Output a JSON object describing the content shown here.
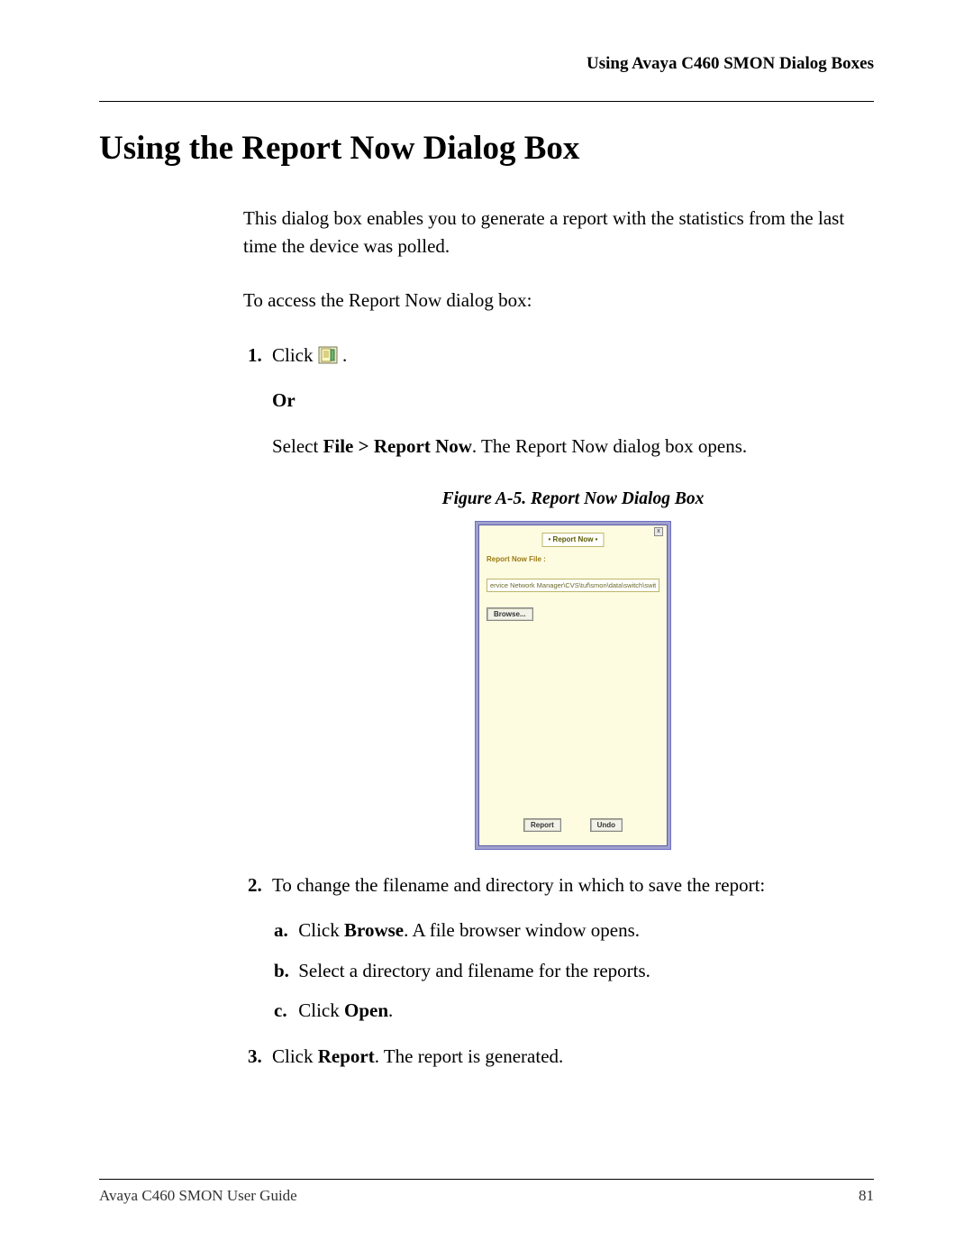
{
  "header": {
    "right": "Using Avaya C460 SMON Dialog Boxes"
  },
  "title": "Using the Report Now Dialog Box",
  "intro": "This dialog box enables you to generate a report with the statistics from the last time the device was polled.",
  "access_line": "To access the Report Now dialog box:",
  "step1": {
    "click": "Click ",
    "period": ".",
    "or": "Or",
    "select_prefix": "Select ",
    "select_bold": "File > Report Now",
    "select_suffix": ". The Report Now dialog box opens."
  },
  "figure": {
    "caption": "Figure A-5.  Report Now Dialog Box"
  },
  "dialog": {
    "tab": "• Report Now •",
    "close": "x",
    "label": "Report Now File :",
    "path": "ervice Network Manager\\CVS\\tuf\\smon\\data\\switch\\switch.now",
    "browse": "Browse...",
    "report": "Report",
    "undo": "Undo"
  },
  "step2": {
    "text": "To change the filename and directory in which to save the report:",
    "a_prefix": "Click ",
    "a_bold": "Browse",
    "a_suffix": ". A file browser window opens.",
    "b": "Select a directory and filename for the reports.",
    "c_prefix": "Click ",
    "c_bold": "Open",
    "c_suffix": "."
  },
  "step3": {
    "prefix": "Click ",
    "bold": "Report",
    "suffix": ". The report is generated."
  },
  "footer": {
    "left": "Avaya C460 SMON User Guide",
    "right": "81"
  }
}
